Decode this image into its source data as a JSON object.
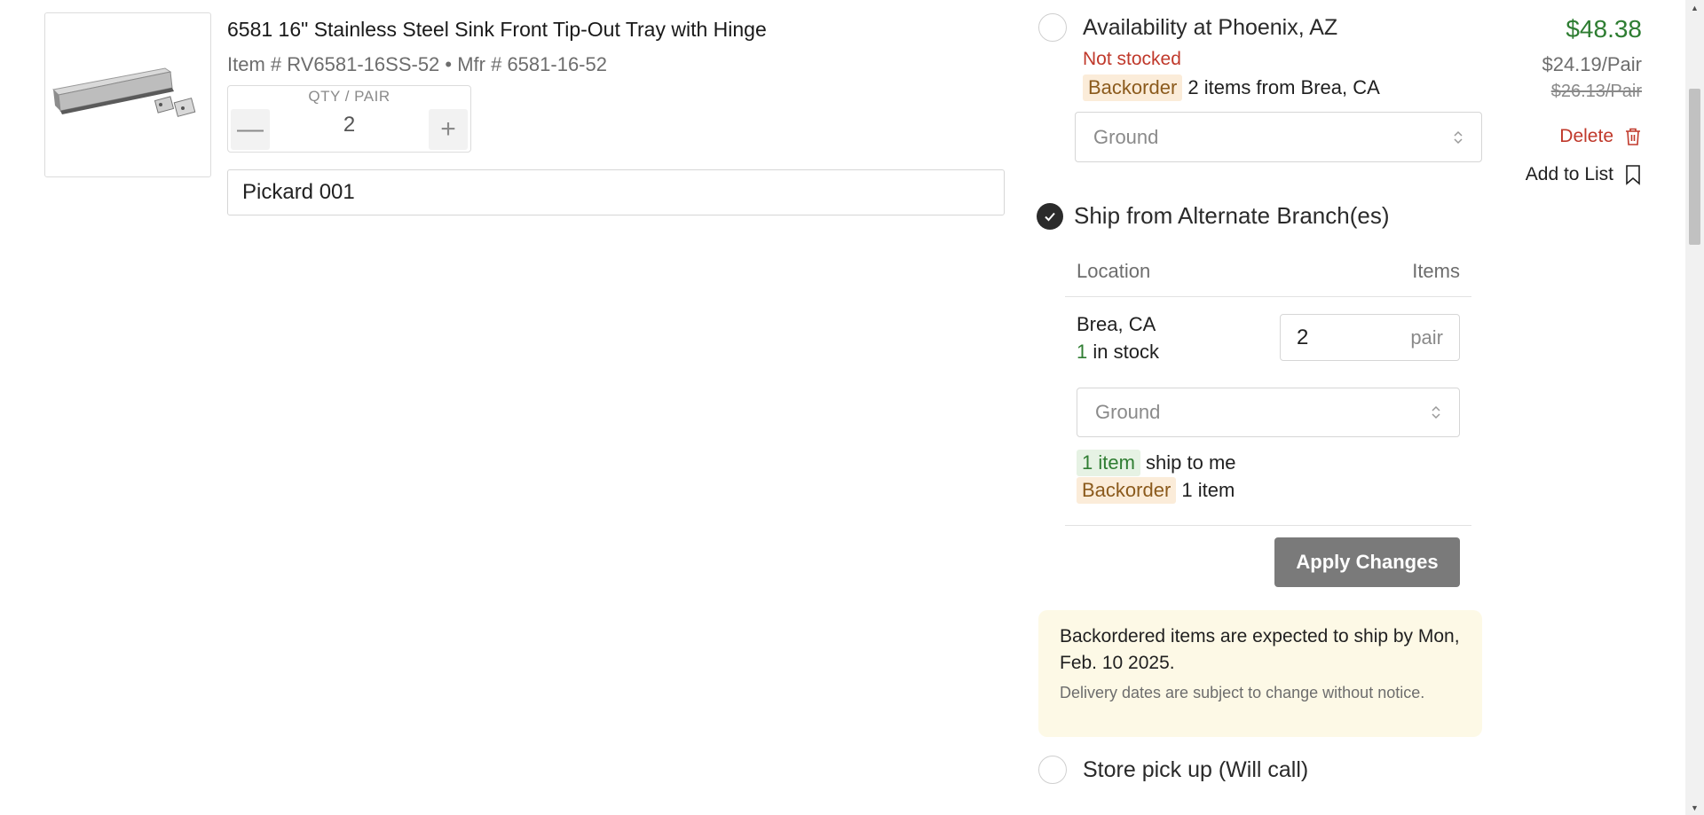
{
  "product": {
    "title": "6581 16\" Stainless Steel Sink Front Tip-Out Tray with Hinge",
    "meta": "Item # RV6581-16SS-52 • Mfr # 6581-16-52",
    "image_icon": "tip-out-tray-photo"
  },
  "quantity": {
    "label": "QTY / PAIR",
    "value": "2",
    "minus": "—",
    "plus": "+"
  },
  "notes": {
    "value": "Pickard 001"
  },
  "availability": {
    "title": "Availability at Phoenix, AZ",
    "status": "Not stocked",
    "backorder_badge": "Backorder",
    "backorder_text": "2 items from Brea, CA",
    "shipping_method": "Ground"
  },
  "alternate": {
    "title": "Ship from Alternate Branch(es)",
    "col_location": "Location",
    "col_items": "Items",
    "branch": {
      "name": "Brea, CA",
      "stock_count": "1",
      "stock_text": "in stock",
      "qty": "2",
      "unit": "pair",
      "shipping_method": "Ground"
    },
    "ship_badge": "1 item",
    "ship_text": "ship to me",
    "backorder_badge": "Backorder",
    "backorder_text": "1 item",
    "apply_label": "Apply Changes"
  },
  "notice": {
    "main": "Backordered items are expected to ship by Mon, Feb. 10 2025.",
    "sub": "Delivery dates are subject to change without notice."
  },
  "pickup": {
    "title": "Store pick up (Will call)"
  },
  "price": {
    "total": "$48.38",
    "unit": "$24.19/Pair",
    "original": "$26.13/Pair"
  },
  "actions": {
    "delete_label": "Delete",
    "add_to_list_label": "Add to List"
  },
  "colors": {
    "price_green": "#2e7d32",
    "delete_red": "#c0392b",
    "apply_button": "#7a7a7a",
    "notice_bg": "#fdf9e6"
  }
}
